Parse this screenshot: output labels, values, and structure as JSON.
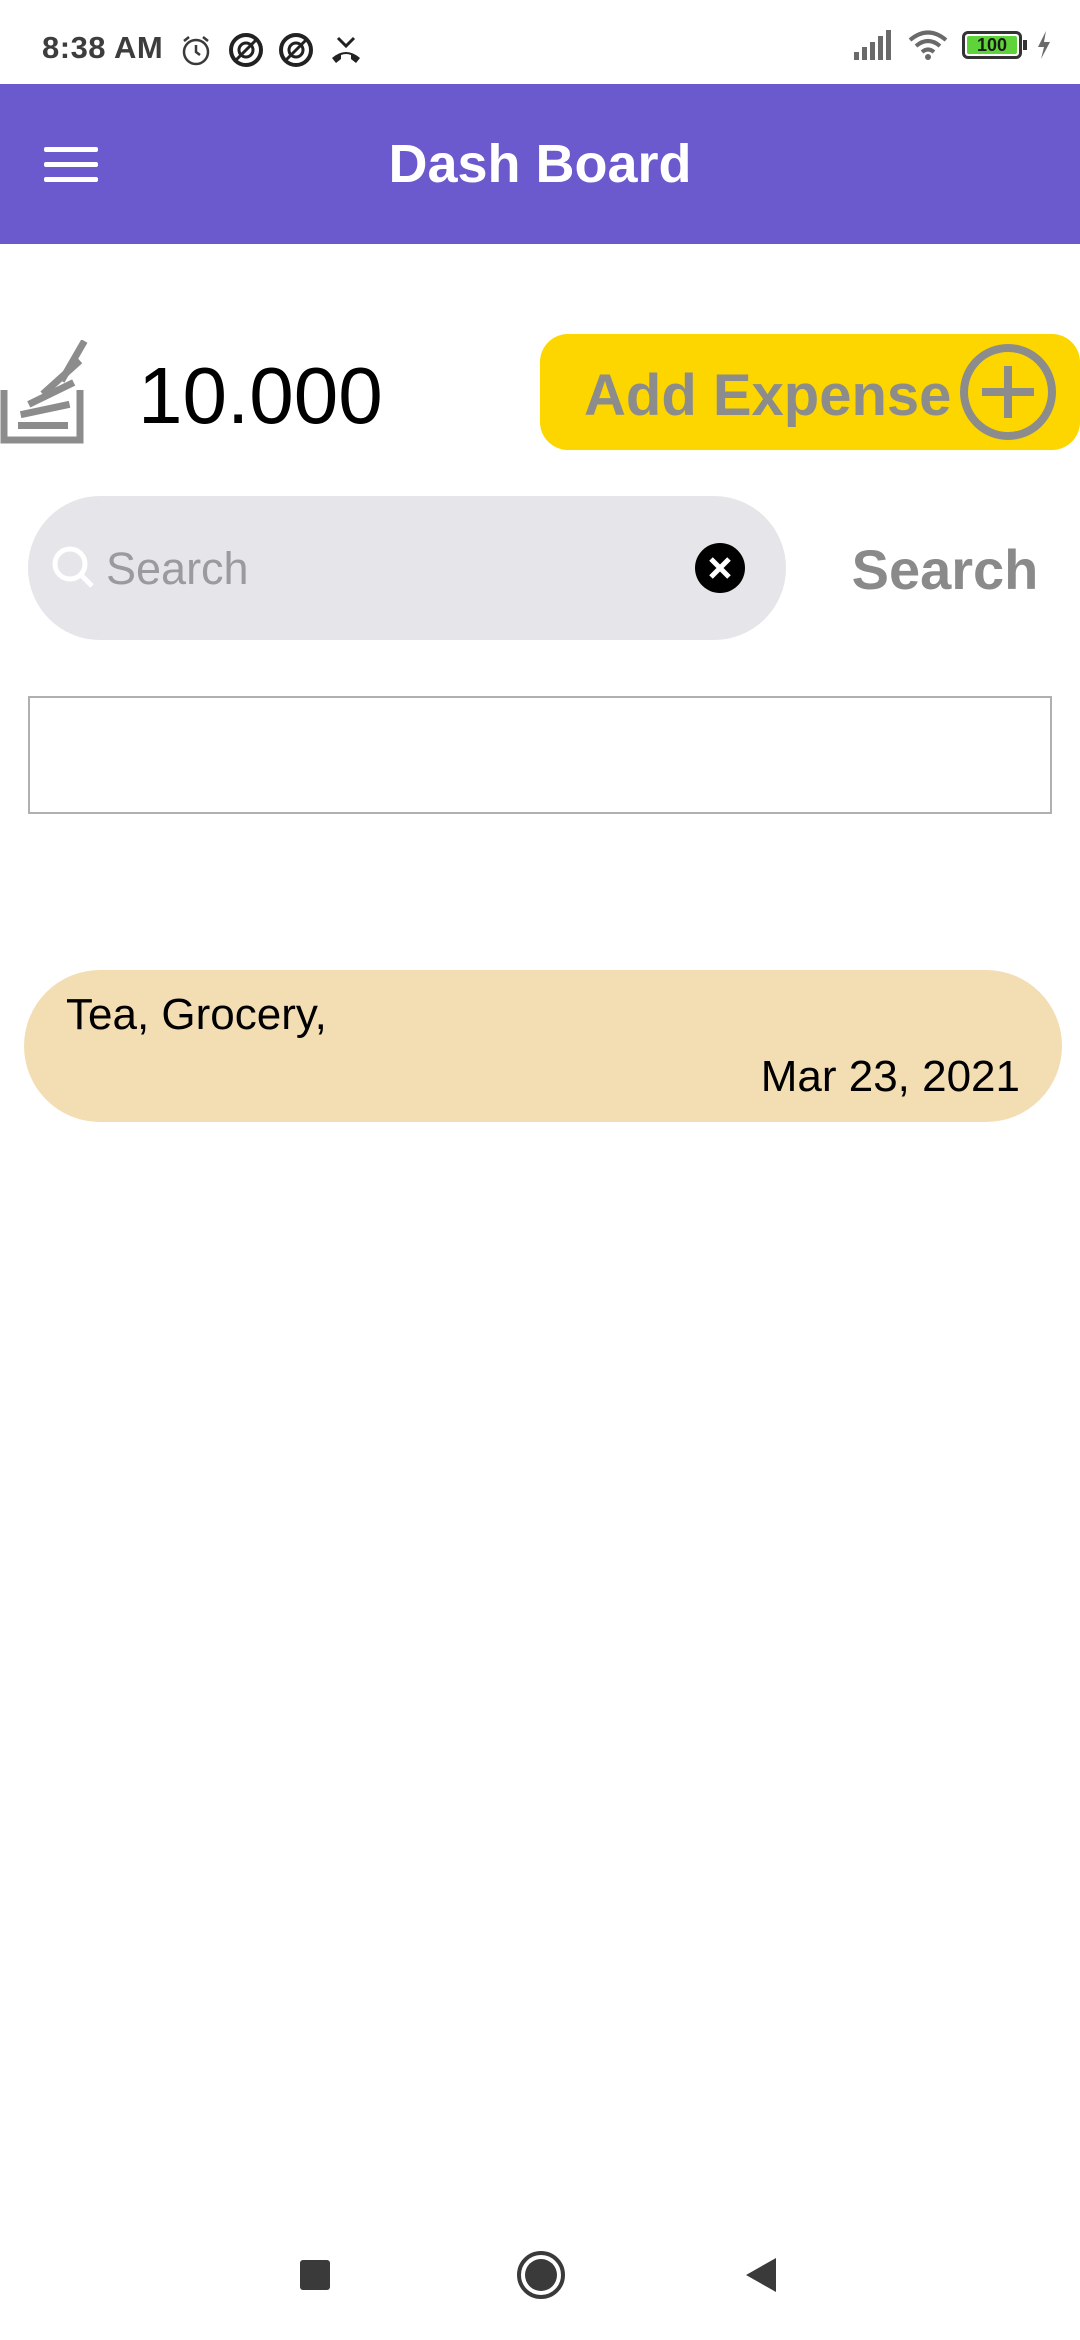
{
  "status_bar": {
    "time": "8:38 AM",
    "battery_level": "100",
    "icons_left": [
      "alarm-icon",
      "blocked-icon",
      "blocked-icon",
      "missed-call-icon"
    ],
    "icons_right": [
      "signal-icon",
      "wifi-icon",
      "battery-icon",
      "charging-icon"
    ]
  },
  "app_bar": {
    "title": "Dash Board",
    "color": "#6a5acd",
    "menu_icon": "hamburger-menu-icon"
  },
  "balance": {
    "icon": "stack-icon",
    "amount": "10.000"
  },
  "add_expense": {
    "label": "Add Expense",
    "icon": "plus-circle-icon",
    "color": "#fdd600"
  },
  "search": {
    "placeholder": "Search",
    "value": "",
    "button_label": "Search"
  },
  "expenses": [
    {
      "categories": "Tea, Grocery,",
      "date": "Mar 23, 2021",
      "color": "#f3ddb3"
    }
  ],
  "nav_bar": {
    "icons": [
      "recents-icon",
      "home-icon",
      "back-icon"
    ]
  }
}
